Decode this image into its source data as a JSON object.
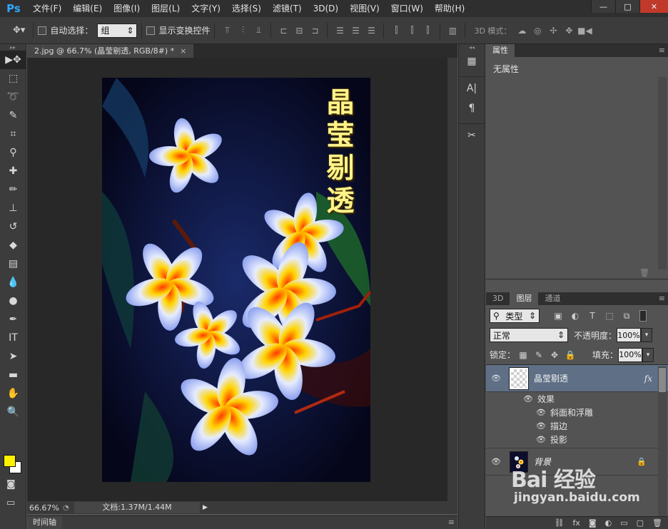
{
  "app": {
    "logo": "Ps"
  },
  "menu": [
    "文件(F)",
    "编辑(E)",
    "图像(I)",
    "图层(L)",
    "文字(Y)",
    "选择(S)",
    "滤镜(T)",
    "3D(D)",
    "视图(V)",
    "窗口(W)",
    "帮助(H)"
  ],
  "window_controls": {
    "minimize": "—",
    "maximize": "□",
    "close": "✕"
  },
  "options_bar": {
    "auto_select_label": "自动选择：",
    "auto_select_value": "组",
    "show_transform_label": "显示变换控件",
    "mode_3d_label": "3D 模式："
  },
  "document": {
    "tab_title": "2.jpg @ 66.7% (晶莹剔透, RGB/8#) *",
    "tab_close": "×",
    "image_text": "晶莹剔透"
  },
  "status": {
    "zoom": "66.67%",
    "doc_size": "文档:1.37M/1.44M"
  },
  "timeline": {
    "label": "时间轴"
  },
  "properties": {
    "tab": "属性",
    "empty_text": "无属性"
  },
  "layers_panel": {
    "tabs": [
      "3D",
      "图层",
      "通道"
    ],
    "active_tab": 1,
    "filter_label": "类型",
    "blend_mode": "正常",
    "opacity_label": "不透明度：",
    "opacity_value": "100%",
    "lock_label": "锁定：",
    "fill_label": "填充：",
    "fill_value": "100%",
    "layers": [
      {
        "name": "晶莹剔透",
        "fx": "fx",
        "selected": true
      },
      {
        "name": "背景",
        "locked": true
      }
    ],
    "effects_label": "效果",
    "effects": [
      "斜面和浮雕",
      "描边",
      "投影"
    ]
  },
  "watermark": {
    "logo": "Bai 经验",
    "url": "jingyan.baidu.com"
  },
  "colors": {
    "foreground": "#fff200",
    "background": "#ffffff",
    "selected_layer": "#5e6f86",
    "accent": "#31a8ff"
  }
}
